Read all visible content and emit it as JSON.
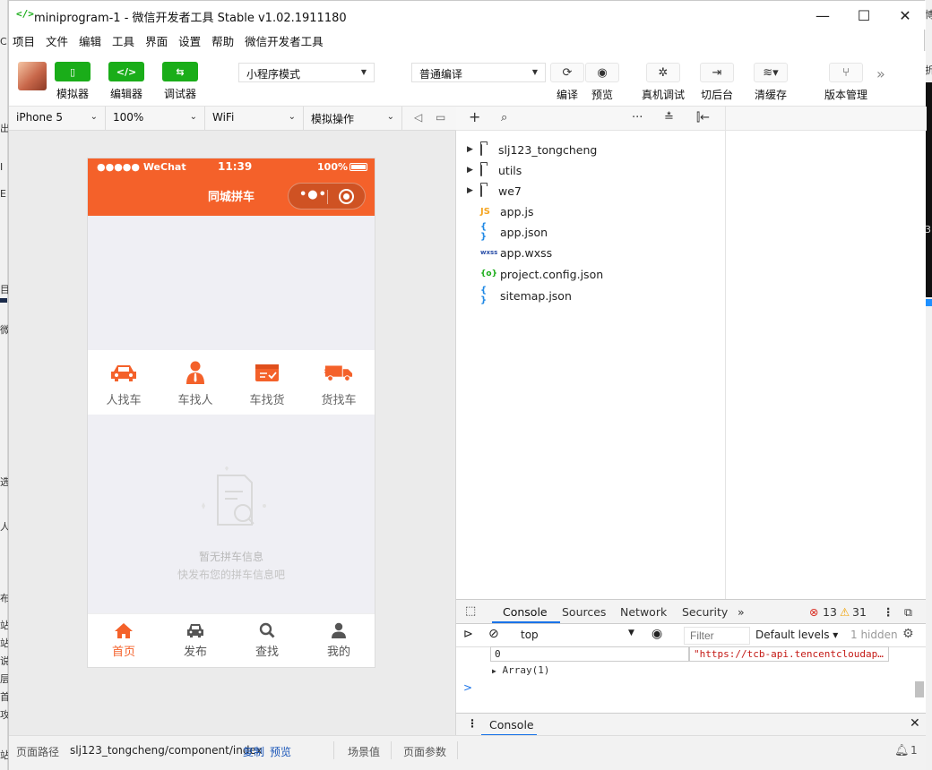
{
  "window": {
    "title_icon": "</>",
    "title": "miniprogram-1 - 微信开发者工具 Stable v1.02.1911180",
    "controls": {
      "minimize": "—",
      "maximize": "☐",
      "close": "✕"
    }
  },
  "menu": [
    "项目",
    "文件",
    "编辑",
    "工具",
    "界面",
    "设置",
    "帮助",
    "微信开发者工具"
  ],
  "toolbar": {
    "modes": [
      {
        "label": "模拟器",
        "glyph": "▯"
      },
      {
        "label": "编辑器",
        "glyph": "</>"
      },
      {
        "label": "调试器",
        "glyph": "⇆"
      }
    ],
    "mode_select": "小程序模式",
    "compile_select": "普通编译",
    "actions": [
      {
        "label": "编译",
        "glyph": "⟳"
      },
      {
        "label": "预览",
        "glyph": "◉"
      },
      {
        "label": "真机调试",
        "glyph": "✲"
      },
      {
        "label": "切后台",
        "glyph": "⇥"
      },
      {
        "label": "清缓存",
        "glyph": "≋▾"
      },
      {
        "label": "版本管理",
        "glyph": "⑂"
      }
    ],
    "more": "»"
  },
  "simulator": {
    "device": "iPhone 5",
    "zoom": "100%",
    "network": "WiFi",
    "operation": "模拟操作",
    "status": {
      "carrier": "●●●●● WeChat",
      "time": "11:39",
      "battery": "100%"
    },
    "nav_title": "同城拼车",
    "categories": [
      {
        "label": "人找车",
        "icon": "car-icon"
      },
      {
        "label": "车找人",
        "icon": "person-icon"
      },
      {
        "label": "车找货",
        "icon": "cargo-box-icon"
      },
      {
        "label": "货找车",
        "icon": "truck-icon"
      }
    ],
    "empty": {
      "line1": "暂无拼车信息",
      "line2": "快发布您的拼车信息吧"
    },
    "tabs": [
      {
        "label": "首页",
        "icon": "home-icon",
        "active": true
      },
      {
        "label": "发布",
        "icon": "car-front-icon",
        "active": false
      },
      {
        "label": "查找",
        "icon": "search-icon",
        "active": false
      },
      {
        "label": "我的",
        "icon": "user-icon",
        "active": false
      }
    ],
    "accent": "#f4612a"
  },
  "tree": {
    "toolbar": {
      "add": "+",
      "search": "⌕",
      "more": "···",
      "sort": "≛",
      "collapse": "⫿←"
    },
    "items": [
      {
        "name": "slj123_tongcheng",
        "type": "folder"
      },
      {
        "name": "utils",
        "type": "folder"
      },
      {
        "name": "we7",
        "type": "folder"
      },
      {
        "name": "app.js",
        "type": "js",
        "badge": "JS"
      },
      {
        "name": "app.json",
        "type": "json",
        "badge": "{ }"
      },
      {
        "name": "app.wxss",
        "type": "wxss",
        "badge": "wxss"
      },
      {
        "name": "project.config.json",
        "type": "config",
        "badge": "{o}"
      },
      {
        "name": "sitemap.json",
        "type": "json",
        "badge": "{ }"
      }
    ]
  },
  "devtools": {
    "tabs": [
      "Console",
      "Sources",
      "Network",
      "Security"
    ],
    "more": "»",
    "errors": "13",
    "warnings": "31",
    "context": "top",
    "filter_placeholder": "Filter",
    "levels": "Default levels ▾",
    "hidden": "1 hidden",
    "row_index": "0",
    "row_value": "\"https://tcb-api.tencentcloudap…",
    "array_row": "Array(1)",
    "prompt": ">",
    "drawer_tab": "Console"
  },
  "statusbar": {
    "path_label": "页面路径",
    "path": "slj123_tongcheng/component/index",
    "copy": "复制",
    "preview": "预览",
    "scene": "场景值",
    "params": "页面参数",
    "bell_count": "1"
  }
}
